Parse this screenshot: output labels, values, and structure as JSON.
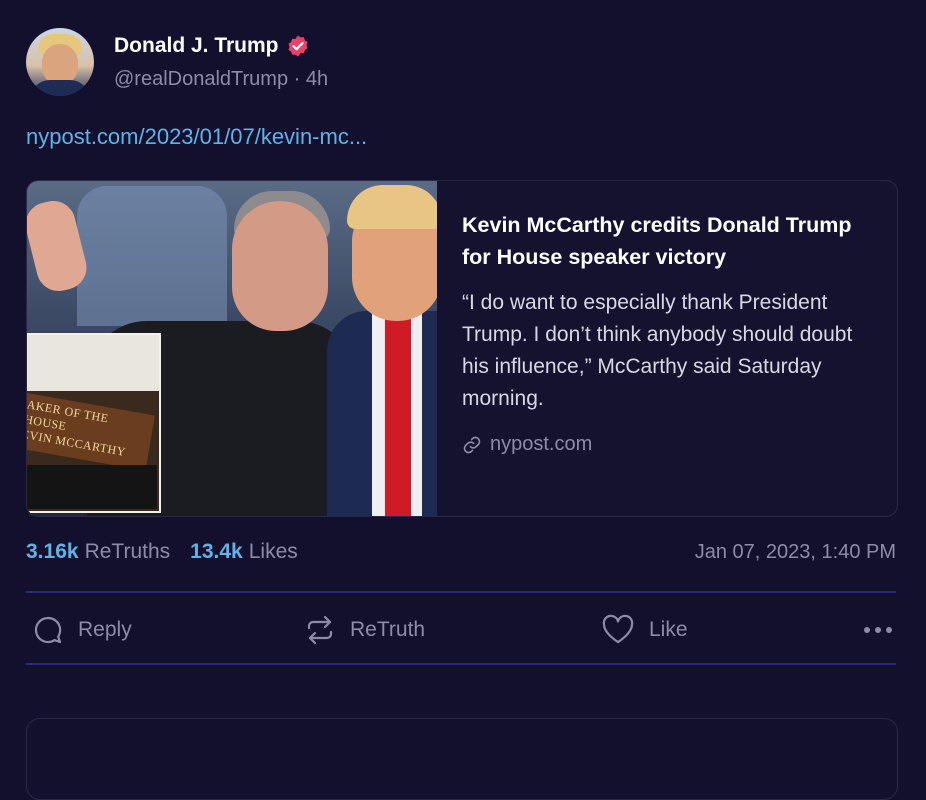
{
  "post": {
    "author_name": "Donald J. Trump",
    "handle": "@realDonaldTrump",
    "separator": "·",
    "time_ago": "4h",
    "link_text": "nypost.com/2023/01/07/kevin-mc..."
  },
  "card": {
    "title": "Kevin McCarthy credits Donald Trump for House speaker victory",
    "description": "“I do want to especially thank President Trump. I don’t think anybody should doubt his influence,” McCarthy said Saturday morning.",
    "source": "nypost.com",
    "plaque_line1": "AKER OF THE HOUSE",
    "plaque_line2": "EVIN MCCARTHY"
  },
  "stats": {
    "retruths_count": "3.16k",
    "retruths_label": "ReTruths",
    "likes_count": "13.4k",
    "likes_label": "Likes",
    "timestamp": "Jan 07, 2023, 1:40 PM"
  },
  "actions": {
    "reply": "Reply",
    "retruth": "ReTruth",
    "like": "Like"
  },
  "icons": {
    "verified": "verified-badge-icon",
    "link": "link-icon",
    "reply": "speech-bubble-icon",
    "retruth": "repost-arrows-icon",
    "like": "heart-icon",
    "more": "ellipsis-icon"
  },
  "colors": {
    "background": "#13102e",
    "accent": "#5fb3e8",
    "verified": "#e9426a",
    "divider": "#2b2880",
    "muted": "#8e8aa8"
  }
}
